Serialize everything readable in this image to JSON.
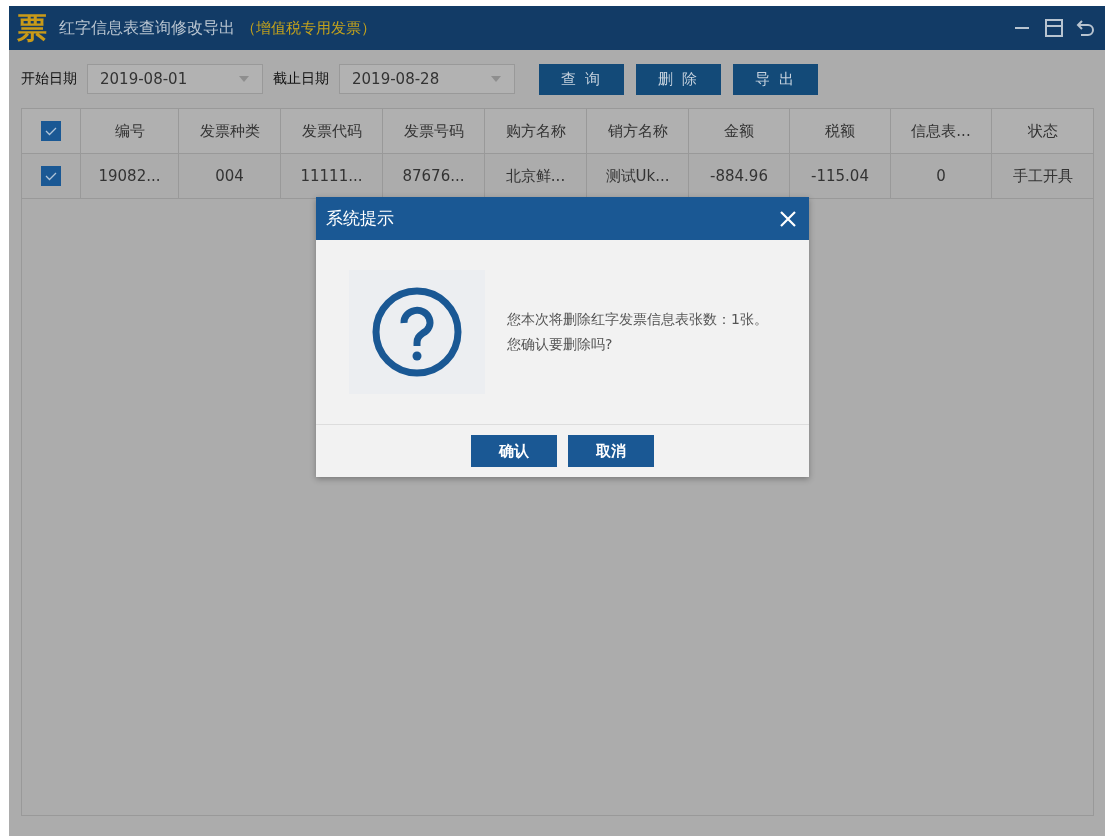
{
  "window": {
    "logo": "票",
    "title": "红字信息表查询修改导出",
    "subtitle": "（增值税专用发票）"
  },
  "filters": [
    {
      "label": "开始日期",
      "value": "2019-08-01"
    },
    {
      "label": "截止日期",
      "value": "2019-08-28"
    }
  ],
  "buttons": [
    "查 询",
    "删 除",
    "导 出"
  ],
  "table": {
    "header_checked": true,
    "columns": [
      "编号",
      "发票种类",
      "发票代码",
      "发票号码",
      "购方名称",
      "销方名称",
      "金额",
      "税额",
      "信息表...",
      "状态"
    ],
    "rows": [
      {
        "checked": true,
        "cells": [
          "19082...",
          "004",
          "11111...",
          "87676...",
          "北京鲜...",
          "测试Uk...",
          "-884.96",
          "-115.04",
          "0",
          "手工开具"
        ]
      }
    ]
  },
  "dialog": {
    "title": "系统提示",
    "message": "您本次将删除红字发票信息表张数：1张。您确认要删除吗?",
    "buttons": [
      "确认",
      "取消"
    ]
  }
}
